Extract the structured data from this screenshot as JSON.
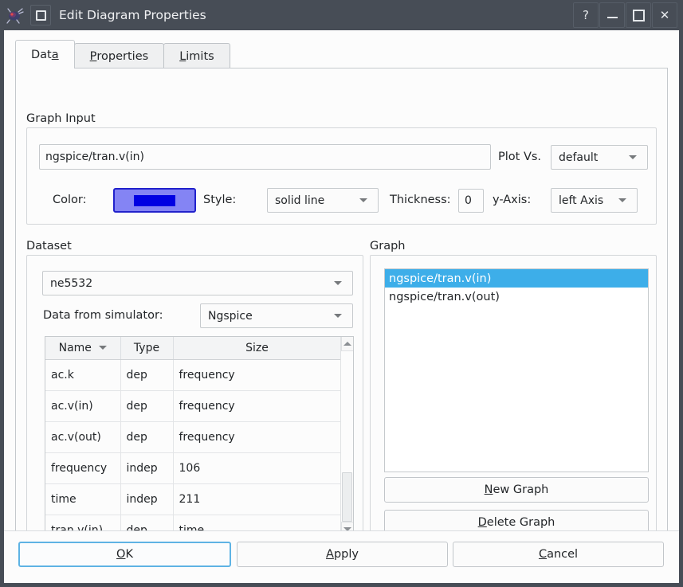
{
  "window": {
    "title": "Edit Diagram Properties",
    "app_icon": "qucs-app-icon",
    "window_menu_icon": "window-menu-icon",
    "controls": {
      "help": "?",
      "minimize": "minimize-icon",
      "maximize": "maximize-icon",
      "close": "✕"
    }
  },
  "tabs": [
    {
      "label": "Data",
      "acc": "a",
      "pre": "Dat",
      "post": "",
      "active": true
    },
    {
      "label": "Properties",
      "acc": "P",
      "pre": "",
      "post": "roperties",
      "active": false
    },
    {
      "label": "Limits",
      "acc": "L",
      "pre": "",
      "post": "imits",
      "active": false
    }
  ],
  "graph_input": {
    "title": "Graph Input",
    "expression": "ngspice/tran.v(in)",
    "expression_placeholder": "",
    "plot_vs_label": "Plot Vs.",
    "plot_vs_value": "default",
    "color_label": "Color:",
    "color_value": "#0000e2",
    "color_button_bg": "#8484f4",
    "style_label": "Style:",
    "style_value": "solid line",
    "thickness_label": "Thickness:",
    "thickness_value": "0",
    "yaxis_label": "y-Axis:",
    "yaxis_value": "left Axis"
  },
  "dataset": {
    "title": "Dataset",
    "dataset_value": "ne5532",
    "simulator_label": "Data from simulator:",
    "simulator_value": "Ngspice",
    "columns": [
      "Name",
      "Type",
      "Size"
    ],
    "sorted_column": "Name",
    "rows": [
      {
        "name": "ac.k",
        "type": "dep",
        "size": "frequency"
      },
      {
        "name": "ac.v(in)",
        "type": "dep",
        "size": "frequency"
      },
      {
        "name": "ac.v(out)",
        "type": "dep",
        "size": "frequency"
      },
      {
        "name": "frequency",
        "type": "indep",
        "size": "106"
      },
      {
        "name": "time",
        "type": "indep",
        "size": "211"
      },
      {
        "name": "tran.v(in)",
        "type": "dep",
        "size": "time"
      }
    ]
  },
  "graph": {
    "title": "Graph",
    "items": [
      {
        "label": "ngspice/tran.v(in)",
        "selected": true
      },
      {
        "label": "ngspice/tran.v(out)",
        "selected": false
      }
    ],
    "new_graph": {
      "acc": "N",
      "pre": "",
      "post": "ew Graph"
    },
    "delete_graph": {
      "acc": "D",
      "pre": "",
      "post": "elete Graph"
    }
  },
  "footer": {
    "ok": {
      "acc": "O",
      "pre": "",
      "post": "K"
    },
    "apply": {
      "acc": "A",
      "pre": "",
      "post": "pply"
    },
    "cancel": {
      "acc": "C",
      "pre": "",
      "post": "ancel"
    }
  },
  "colors": {
    "titlebar": "#474d56",
    "dialog_bg": "#fcfcfc",
    "selection": "#3daee9",
    "focus": "#5eb3e4"
  }
}
